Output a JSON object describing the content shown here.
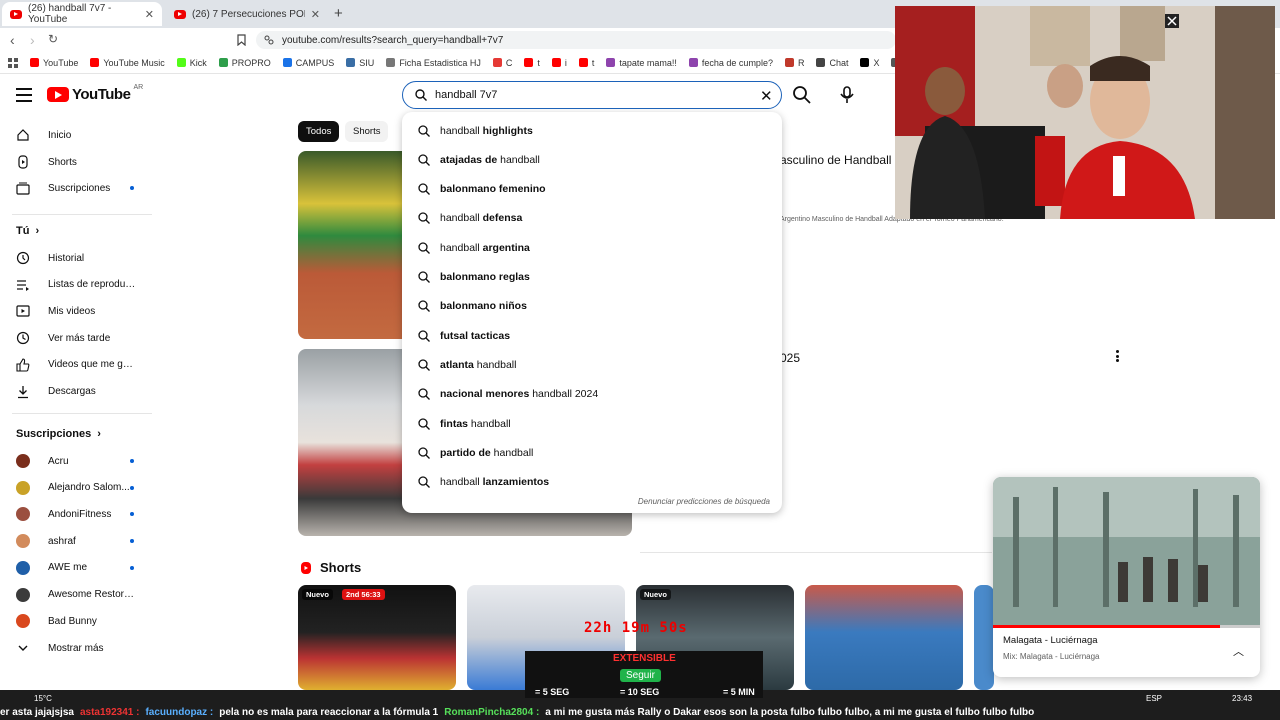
{
  "browser": {
    "tabs": [
      {
        "title": "(26) handball 7v7 - YouTube",
        "active": true
      },
      {
        "title": "(26) 7 Persecuciones POLICIALES en l",
        "active": false
      }
    ],
    "url": "youtube.com/results?search_query=handball+7v7",
    "bookmarks": [
      {
        "label": "YouTube",
        "color": "#ff0000"
      },
      {
        "label": "YouTube Music",
        "color": "#ff0000"
      },
      {
        "label": "Kick",
        "color": "#53fc18"
      },
      {
        "label": "PROPRO",
        "color": "#2e9e4b"
      },
      {
        "label": "CAMPUS",
        "color": "#1a73e8"
      },
      {
        "label": "SIU",
        "color": "#3a6ea5"
      },
      {
        "label": "Ficha Estadistica HJ",
        "color": "#777777"
      },
      {
        "label": "C",
        "color": "#e53935"
      },
      {
        "label": "t",
        "color": "#ff0000"
      },
      {
        "label": "i",
        "color": "#ff0000"
      },
      {
        "label": "t",
        "color": "#ff0000"
      },
      {
        "label": "tapate mama!!",
        "color": "#8e44ad"
      },
      {
        "label": "fecha de cumple?",
        "color": "#8e44ad"
      },
      {
        "label": "R",
        "color": "#c0392b"
      },
      {
        "label": "Chat",
        "color": "#444444"
      },
      {
        "label": "X",
        "color": "#000000"
      },
      {
        "label": "ED",
        "color": "#555555"
      }
    ]
  },
  "header": {
    "logo_text": "YouTube",
    "country": "AR",
    "search_value": "handball 7v7"
  },
  "sidebar": {
    "main": [
      {
        "label": "Inicio",
        "icon": "home-icon"
      },
      {
        "label": "Shorts",
        "icon": "shorts-icon"
      },
      {
        "label": "Suscripciones",
        "icon": "subscriptions-icon",
        "dot": true
      }
    ],
    "you_title": "Tú",
    "you": [
      {
        "label": "Historial",
        "icon": "history-icon"
      },
      {
        "label": "Listas de reproducc...",
        "icon": "playlist-icon"
      },
      {
        "label": "Mis videos",
        "icon": "my-videos-icon"
      },
      {
        "label": "Ver más tarde",
        "icon": "clock-icon"
      },
      {
        "label": "Videos que me gus...",
        "icon": "like-icon"
      },
      {
        "label": "Descargas",
        "icon": "download-icon"
      }
    ],
    "subs_title": "Suscripciones",
    "subs": [
      {
        "label": "Acru",
        "color": "#7a2e1c"
      },
      {
        "label": "Alejandro Salom...",
        "color": "#c9a227"
      },
      {
        "label": "AndoniFitness",
        "color": "#9b4f3f"
      },
      {
        "label": "ashraf",
        "color": "#d28b5c"
      },
      {
        "label": "AWE me",
        "color": "#1f5fa8"
      },
      {
        "label": "Awesome Restorati...",
        "color": "#3b3b3b"
      },
      {
        "label": "Bad Bunny",
        "color": "#d9481e"
      }
    ],
    "more_label": "Mostrar más"
  },
  "chips": [
    "Todos",
    "Shorts"
  ],
  "results": {
    "r1_title": "asculino de Handball",
    "r1_desc": "Argentino Masculino de Handball Adaptado en el Torneo Panamericano.",
    "r2_title": "025"
  },
  "suggestions": [
    {
      "pre": "handball ",
      "bold": "highlights",
      "post": ""
    },
    {
      "pre": "",
      "bold": "atajadas de",
      "post": " handball"
    },
    {
      "pre": "",
      "bold": "balonmano femenino",
      "post": ""
    },
    {
      "pre": "handball ",
      "bold": "defensa",
      "post": ""
    },
    {
      "pre": "handball ",
      "bold": "argentina",
      "post": ""
    },
    {
      "pre": "",
      "bold": "balonmano reglas",
      "post": ""
    },
    {
      "pre": "",
      "bold": "balonmano niños",
      "post": ""
    },
    {
      "pre": "",
      "bold": "futsal tacticas",
      "post": ""
    },
    {
      "pre": "",
      "bold": "atlanta",
      "post": " handball"
    },
    {
      "pre": "",
      "bold": "nacional menores",
      "post": " handball 2024"
    },
    {
      "pre": "",
      "bold": "fintas",
      "post": " handball"
    },
    {
      "pre": "",
      "bold": "partido de",
      "post": " handball"
    },
    {
      "pre": "handball ",
      "bold": "lanzamientos",
      "post": ""
    }
  ],
  "suggest_report": "Denunciar predicciones de búsqueda",
  "shorts": {
    "title": "Shorts",
    "badge_new": "Nuevo",
    "badge_live": "2nd 56:33",
    "badge_new2": "Nuevo"
  },
  "miniplayer": {
    "title": "Malagata - Luciérnaga",
    "subtitle": "Mix: Malagata - Luciérnaga",
    "progress": 0.85
  },
  "overlay": {
    "timer": "22h 19m 50s",
    "extensible": "EXTENSIBLE",
    "seguir": "Seguir",
    "t1": "= 5 SEG",
    "t2": "= 10 SEG",
    "t3": "= 5 MIN"
  },
  "taskbar": {
    "temp": "15°C",
    "lang": "ESP",
    "time": "23:43",
    "ticker": [
      {
        "text": "er asta jajajsjsa",
        "type": "msg"
      },
      {
        "text": "asta192341 :",
        "type": "name"
      },
      {
        "text": "facuundopaz :",
        "type": "nameb"
      },
      {
        "text": "pela no es mala para reaccionar a la fórmula 1",
        "type": "msg"
      },
      {
        "text": "RomanPincha2804 :",
        "type": "nameg"
      },
      {
        "text": "a mi me gusta más Rally o Dakar  esos son la posta  fulbo fulbo fulbo, a mi me gusta el fulbo fulbo fulbo",
        "type": "msg"
      }
    ]
  }
}
